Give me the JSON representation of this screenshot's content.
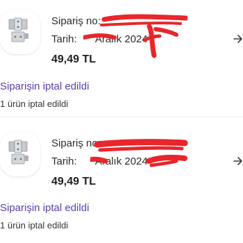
{
  "orders": [
    {
      "order_no_label": "Sipariş no:",
      "date_label": "Tarih:",
      "date_value": "Aralık 2024",
      "price": "49,49 TL",
      "status": "Siparişin iptal edildi",
      "substatus": "1 ürün iptal edildi"
    },
    {
      "order_no_label": "Sipariş no:",
      "date_label": "Tarih:",
      "date_value": "Aralık 2024",
      "price": "49,49 TL",
      "status": "Siparişin iptal edildi",
      "substatus": "1 ürün iptal edildi"
    }
  ],
  "colors": {
    "status": "#5b3ea8",
    "redaction": "#e8262b"
  },
  "icons": {
    "product": "door-hinge-icon",
    "navigate": "arrow-right-icon"
  }
}
